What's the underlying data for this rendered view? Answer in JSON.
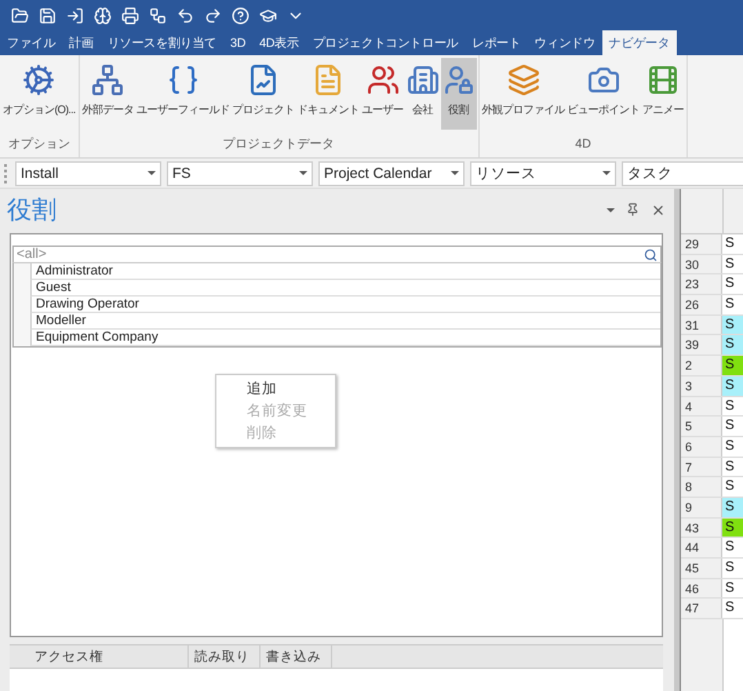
{
  "menu_tabs": [
    {
      "label": "ファイル",
      "selected": false
    },
    {
      "label": "計画",
      "selected": false
    },
    {
      "label": "リソースを割り当て",
      "selected": false
    },
    {
      "label": "3D",
      "selected": false
    },
    {
      "label": "4D表示",
      "selected": false
    },
    {
      "label": "プロジェクトコントロール",
      "selected": false
    },
    {
      "label": "レポート",
      "selected": false
    },
    {
      "label": "ウィンドウ",
      "selected": false
    },
    {
      "label": "ナビゲータ",
      "selected": true
    }
  ],
  "ribbon_groups": [
    {
      "label": "オプション",
      "buttons": [
        {
          "label": "オプション(O)...",
          "kind": "gears",
          "selected": false
        }
      ]
    },
    {
      "label": "プロジェクトデータ",
      "buttons": [
        {
          "label": "外部データ",
          "kind": "network",
          "selected": false
        },
        {
          "label": "ユーザーフィールド",
          "kind": "braces",
          "selected": false
        },
        {
          "label": "プロジェクト",
          "kind": "chart",
          "selected": false
        },
        {
          "label": "ドキュメント",
          "kind": "document",
          "selected": false
        },
        {
          "label": "ユーザー",
          "kind": "users",
          "selected": false
        },
        {
          "label": "会社",
          "kind": "building",
          "selected": false
        },
        {
          "label": "役割",
          "kind": "userlock",
          "selected": true
        }
      ]
    },
    {
      "label": "4D",
      "buttons": [
        {
          "label": "外観プロファイル",
          "kind": "layers",
          "selected": false
        },
        {
          "label": "ビューポイント",
          "kind": "camera",
          "selected": false
        },
        {
          "label": "アニメー",
          "kind": "film",
          "selected": false
        }
      ]
    }
  ],
  "toolbar_dropdowns": [
    "Install",
    "FS",
    "Project Calendar",
    "リソース",
    "タスク"
  ],
  "roles_panel": {
    "title": "役割",
    "filter": "<all>",
    "items": [
      "Administrator",
      "Guest",
      "Drawing Operator",
      "Modeller",
      "Equipment Company"
    ],
    "context_menu": [
      {
        "label": "追加",
        "disabled": false
      },
      {
        "label": "名前変更",
        "disabled": true
      },
      {
        "label": "削除",
        "disabled": true
      }
    ],
    "access_columns": [
      "アクセス権",
      "読み取り",
      "書き込み"
    ]
  },
  "grid_rows": [
    {
      "id": "29",
      "cell": "S",
      "color": "#ffffff"
    },
    {
      "id": "30",
      "cell": "S",
      "color": "#ffffff"
    },
    {
      "id": "23",
      "cell": "S",
      "color": "#ffffff"
    },
    {
      "id": "26",
      "cell": "S",
      "color": "#ffffff"
    },
    {
      "id": "31",
      "cell": "S",
      "color": "#a8f0fa"
    },
    {
      "id": "39",
      "cell": "S",
      "color": "#a8f0fa"
    },
    {
      "id": "2",
      "cell": "S",
      "color": "#80e010"
    },
    {
      "id": "3",
      "cell": "S",
      "color": "#a8f0fa"
    },
    {
      "id": "4",
      "cell": "S",
      "color": "#ffffff"
    },
    {
      "id": "5",
      "cell": "S",
      "color": "#ffffff"
    },
    {
      "id": "6",
      "cell": "S",
      "color": "#ffffff"
    },
    {
      "id": "7",
      "cell": "S",
      "color": "#ffffff"
    },
    {
      "id": "8",
      "cell": "S",
      "color": "#ffffff"
    },
    {
      "id": "9",
      "cell": "S",
      "color": "#a8f0fa"
    },
    {
      "id": "43",
      "cell": "S",
      "color": "#80e010"
    },
    {
      "id": "44",
      "cell": "S",
      "color": "#ffffff"
    },
    {
      "id": "45",
      "cell": "S",
      "color": "#ffffff"
    },
    {
      "id": "46",
      "cell": "S",
      "color": "#ffffff"
    },
    {
      "id": "47",
      "cell": "S",
      "color": "#ffffff"
    }
  ]
}
